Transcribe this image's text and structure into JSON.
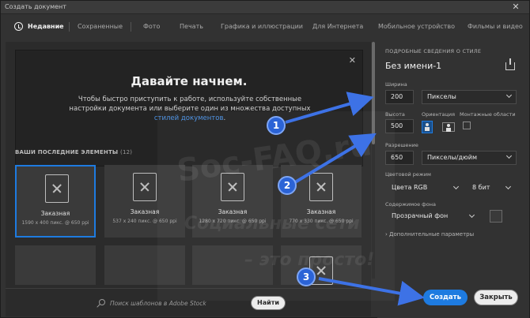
{
  "window": {
    "title": "Создать документ",
    "close_glyph": "✕"
  },
  "tabs": [
    {
      "label": "Недавние",
      "active": true
    },
    {
      "label": "Сохраненные"
    },
    {
      "label": "Фото"
    },
    {
      "label": "Печать"
    },
    {
      "label": "Графика и иллюстрации"
    },
    {
      "label": "Для Интернета"
    },
    {
      "label": "Мобильное устройство"
    },
    {
      "label": "Фильмы и видео"
    }
  ],
  "welcome": {
    "title": "Давайте начнем.",
    "text": "Чтобы быстро приступить к работе, используйте собственные настройки документа или выберите один из множества доступных",
    "link": "стилей документов",
    "after_link": ".",
    "close_glyph": "✕"
  },
  "recent": {
    "title": "ВАШИ ПОСЛЕДНИЕ ЭЛЕМЕНТЫ",
    "count": "(12)",
    "items": [
      {
        "name": "Заказная",
        "info": "1590 x 400 пикс. @ 650 ppi",
        "selected": true
      },
      {
        "name": "Заказная",
        "info": "537 x 240 пикс. @ 650 ppi"
      },
      {
        "name": "Заказная",
        "info": "1280 x 720 пикс. @ 650 ppi"
      },
      {
        "name": "Заказная",
        "info": "770 x 330 пикс. @ 650 ppi"
      }
    ]
  },
  "search": {
    "placeholder": "Поиск шаблонов в Adobe Stock",
    "button": "Найти"
  },
  "details": {
    "section_title": "ПОДРОБНЫЕ СВЕДЕНИЯ О СТИЛЕ",
    "doc_name": "Без имени-1",
    "width_label": "Ширина",
    "width_value": "200",
    "width_unit": "Пикселы",
    "height_label": "Высота",
    "height_value": "500",
    "orientation_label": "Ориентация",
    "artboards_label": "Монтажные области",
    "resolution_label": "Разрешение",
    "resolution_value": "650",
    "resolution_unit": "Пикселы/дюйм",
    "color_mode_label": "Цветовой режим",
    "color_mode_value": "Цвета RGB",
    "bit_depth": "8 бит",
    "background_label": "Содержимое фона",
    "background_value": "Прозрачный фон",
    "advanced": "Дополнительные параметры",
    "advanced_glyph": "›"
  },
  "actions": {
    "create": "Создать",
    "close": "Закрыть"
  },
  "callouts": [
    "1",
    "2",
    "3"
  ],
  "watermark": {
    "site": "Soc-FAQ.ru",
    "line1": "Социальные сети",
    "line2": "– это просто!"
  },
  "colors": {
    "accent": "#1e7be0",
    "callout": "#2b63d6",
    "panel": "#323232",
    "left_panel": "#2b2b2b"
  }
}
